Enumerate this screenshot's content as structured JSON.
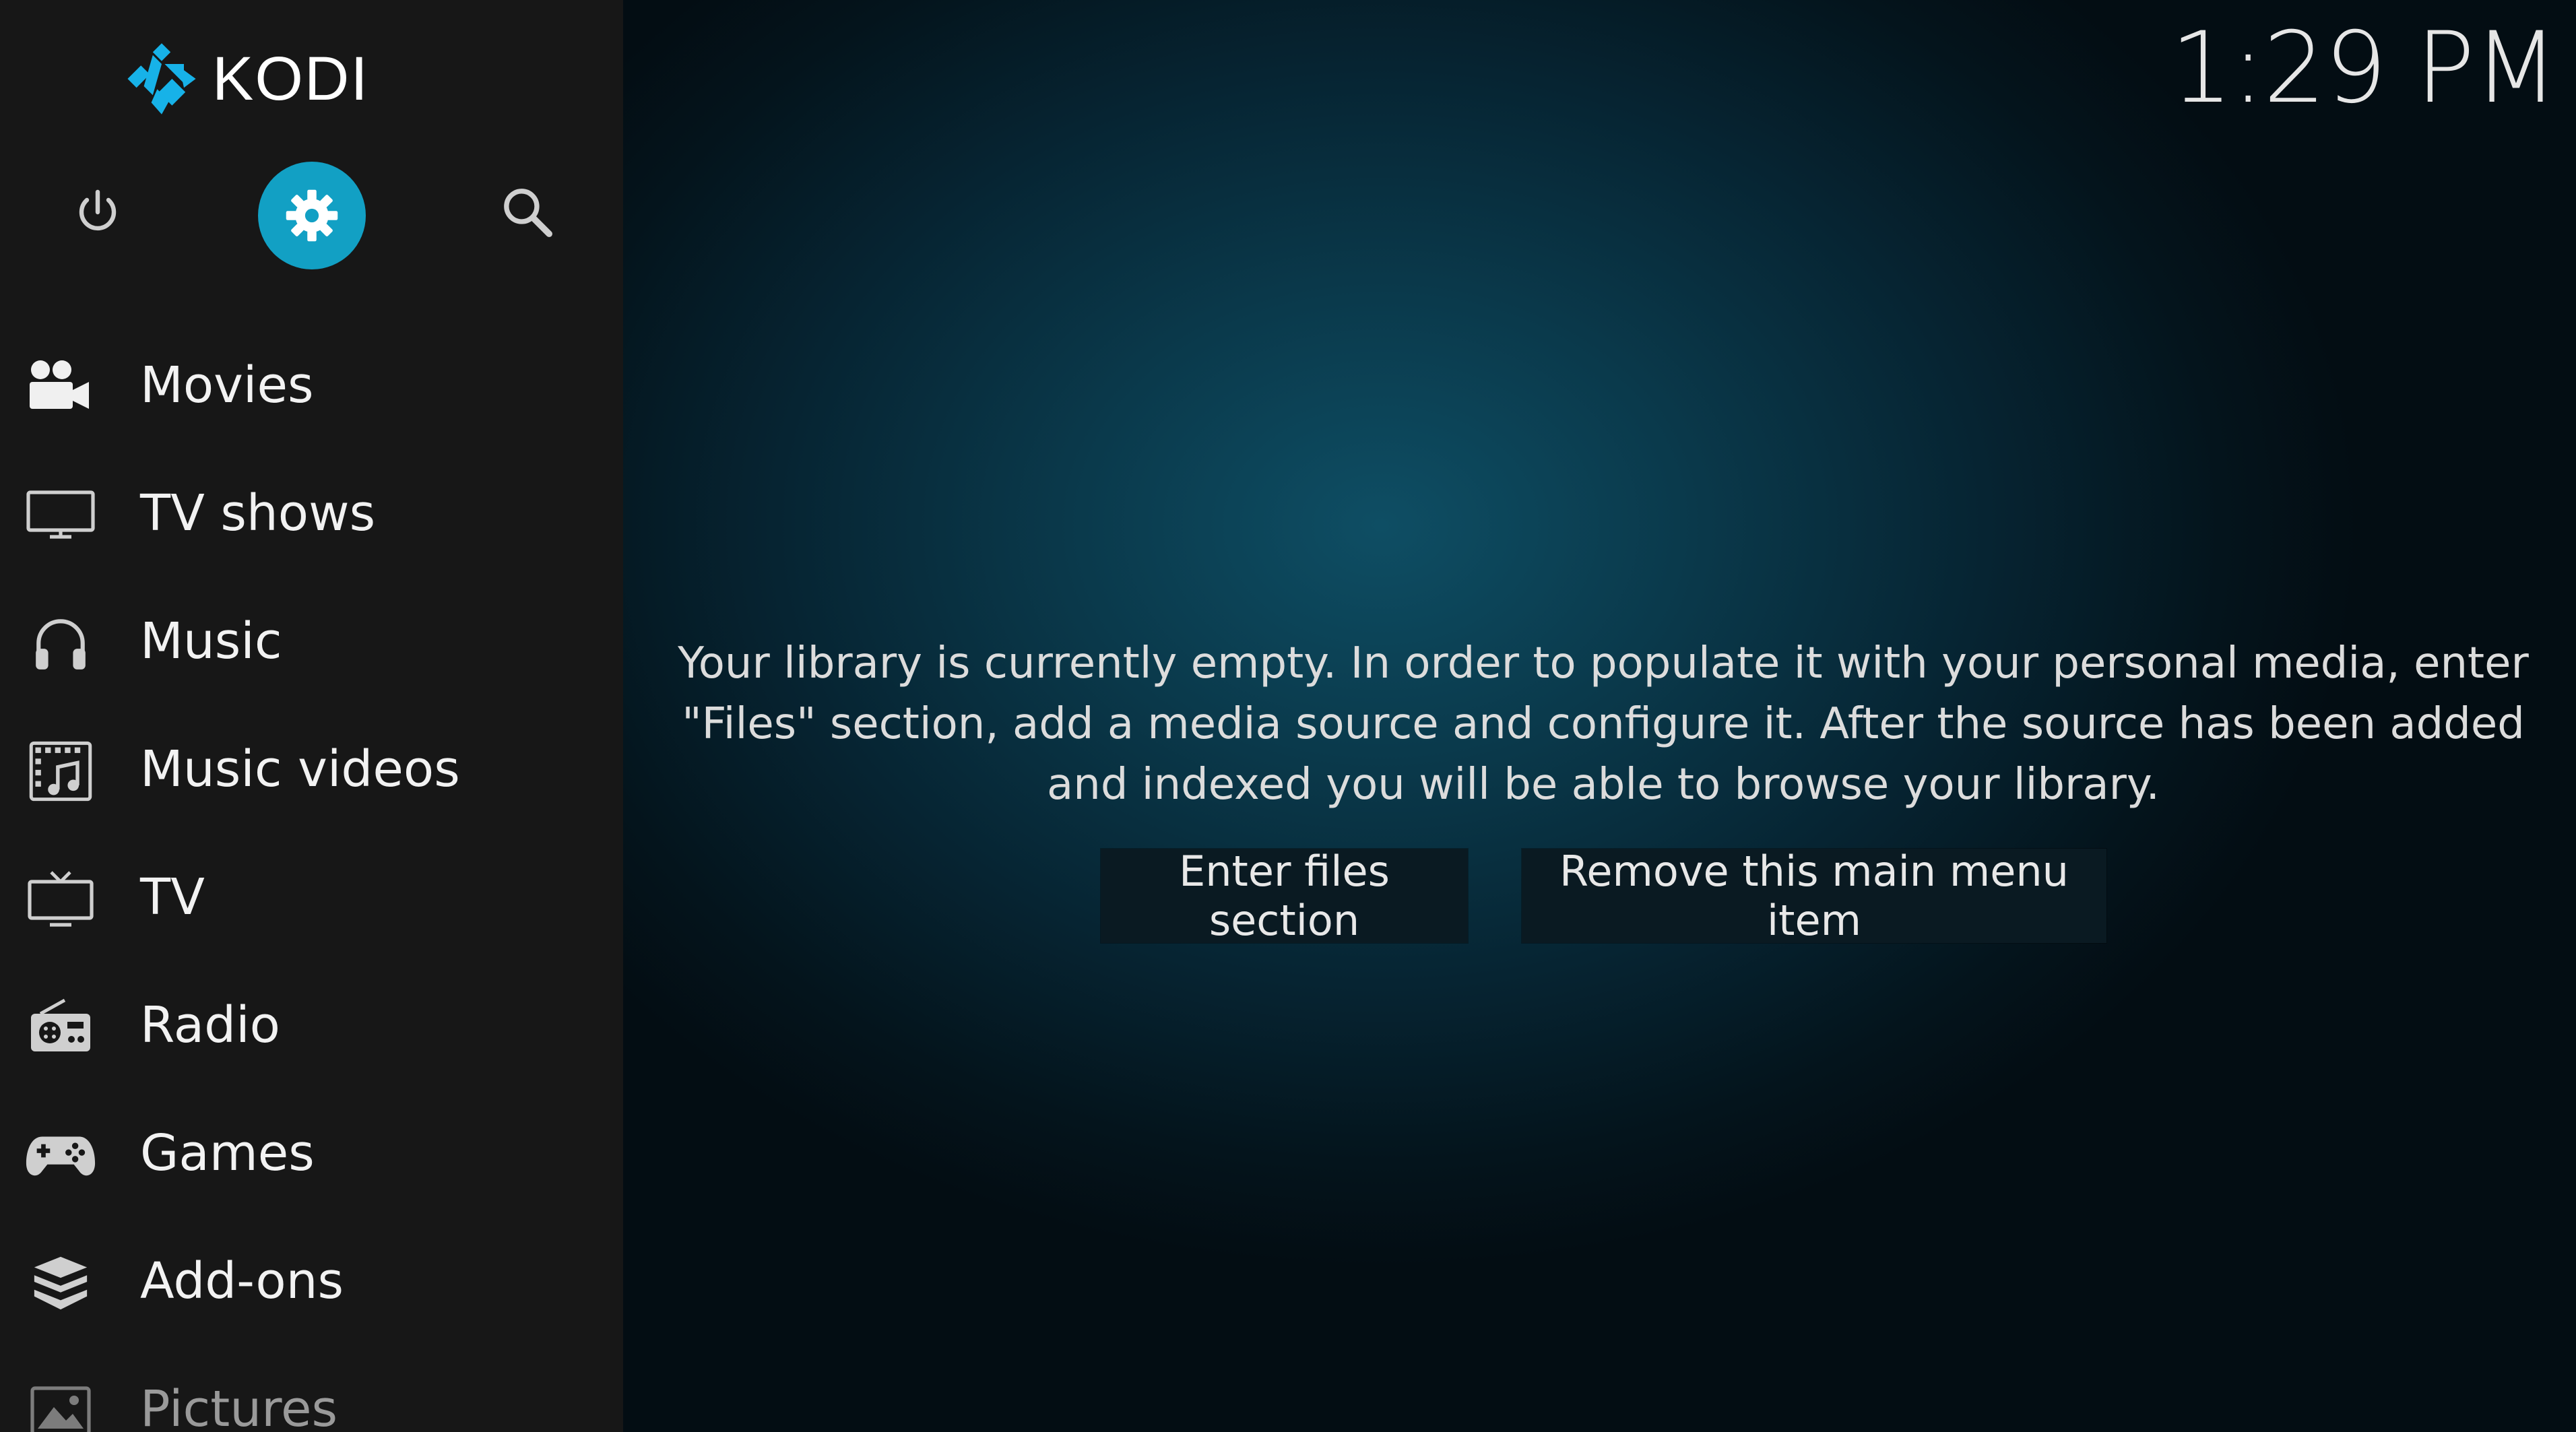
{
  "app": {
    "name": "KODI",
    "clock": "1:29 PM"
  },
  "top_buttons": {
    "power_icon": "power-icon",
    "settings_icon": "gear-icon",
    "search_icon": "search-icon"
  },
  "menu": {
    "items": [
      {
        "label": "Movies",
        "icon": "movies-icon"
      },
      {
        "label": "TV shows",
        "icon": "tv-shows-icon"
      },
      {
        "label": "Music",
        "icon": "headphones-icon"
      },
      {
        "label": "Music videos",
        "icon": "music-videos-icon"
      },
      {
        "label": "TV",
        "icon": "tv-icon"
      },
      {
        "label": "Radio",
        "icon": "radio-icon"
      },
      {
        "label": "Games",
        "icon": "gamepad-icon"
      },
      {
        "label": "Add-ons",
        "icon": "addons-icon"
      },
      {
        "label": "Pictures",
        "icon": "pictures-icon"
      }
    ]
  },
  "main": {
    "message": "Your library is currently empty. In order to populate it with your personal media, enter \"Files\" section, add a media source and configure it. After the source has been added and indexed you will be able to browse your library.",
    "buttons": {
      "enter_files": "Enter files section",
      "remove_item": "Remove this main menu item"
    }
  },
  "colors": {
    "accent": "#12a0c4",
    "sidebar_bg": "#171717",
    "background": "#0a394b"
  }
}
